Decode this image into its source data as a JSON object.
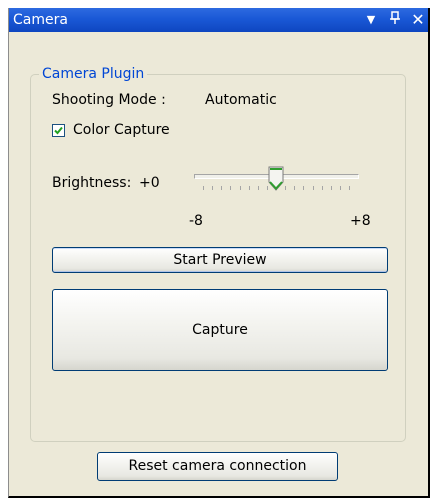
{
  "window": {
    "title": "Camera",
    "dropdown_icon": "triangle-down-icon",
    "pin_icon": "pin-icon",
    "close_icon": "close-icon"
  },
  "group": {
    "legend": "Camera Plugin"
  },
  "shooting_mode": {
    "label": "Shooting Mode :",
    "value": "Automatic"
  },
  "color_capture": {
    "label": "Color Capture",
    "checked": true
  },
  "brightness": {
    "label": "Brightness:",
    "value": "+0",
    "min_label": "-8",
    "max_label": "+8",
    "min": -8,
    "max": 8,
    "current": 0
  },
  "buttons": {
    "start_preview": "Start Preview",
    "capture": "Capture",
    "reset": "Reset camera connection"
  },
  "colors": {
    "title_bar": "#1a58d6",
    "panel_background": "#ece9d8",
    "legend_text": "#0046d5",
    "check_mark": "#21a121",
    "slider_thumb_accent": "#2f9e2f"
  }
}
